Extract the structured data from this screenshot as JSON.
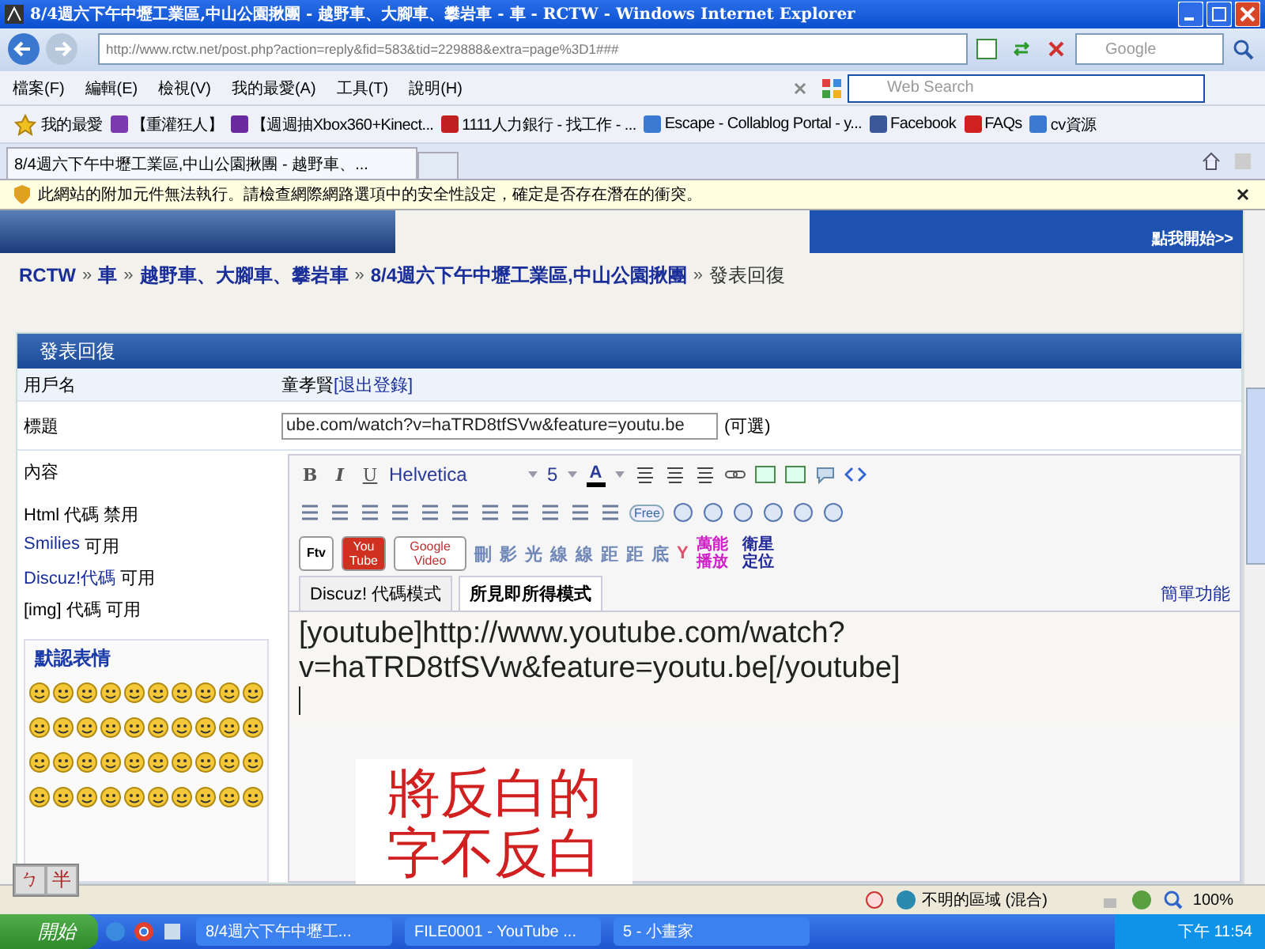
{
  "window": {
    "title": "8/4週六下午中壢工業區,中山公園揪團 - 越野車、大腳車、攀岩車 - 車 - RCTW - Windows Internet Explorer"
  },
  "address_bar": {
    "url": "http://www.rctw.net/post.php?action=reply&fid=583&tid=229888&extra=page%3D1###"
  },
  "search_box": {
    "placeholder": "Google"
  },
  "menu": [
    "檔案(F)",
    "編輯(E)",
    "檢視(V)",
    "我的最愛(A)",
    "工具(T)",
    "說明(H)"
  ],
  "web_search": {
    "placeholder": "Web Search"
  },
  "favorites_bar": {
    "label": "我的最愛",
    "items": [
      "【重灌狂人】",
      "【週週抽Xbox360+Kinect...",
      "1111人力銀行 - 找工作 - ...",
      "Escape - Collablog Portal - y...",
      "Facebook",
      "FAQs",
      "cv資源"
    ]
  },
  "tabs": [
    {
      "label": "8/4週六下午中壢工業區,中山公園揪團 - 越野車、...",
      "selected": true
    }
  ],
  "info_bar": {
    "message": "此網站的附加元件無法執行。請檢查網際網路選項中的安全性設定，確定是否存在潛在的衝突。"
  },
  "banner": {
    "link": "點我開始>>"
  },
  "breadcrumb": [
    {
      "text": "RCTW",
      "kind": "link"
    },
    {
      "text": "»",
      "kind": "separator"
    },
    {
      "text": "車",
      "kind": "link"
    },
    {
      "text": "»",
      "kind": "separator"
    },
    {
      "text": "越野車、大腳車、攀岩車",
      "kind": "link"
    },
    {
      "text": "»",
      "kind": "separator"
    },
    {
      "text": "8/4週六下午中壢工業區,中山公園揪團",
      "kind": "link"
    },
    {
      "text": "»",
      "kind": "separator"
    },
    {
      "text": "發表回復",
      "kind": "current"
    }
  ],
  "form": {
    "title": "發表回復",
    "username_label": "用戶名",
    "username": "童孝賢",
    "logout_link": "[退出登錄]",
    "subject_label": "標題",
    "subject_value": "ube.com/watch?v=haTRD8tfSVw&feature=youtu.be",
    "subject_note": "(可選)",
    "content_label": "內容",
    "options": [
      {
        "name": "Html 代碼",
        "status": "禁用",
        "kind": "plain"
      },
      {
        "name": "Smilies",
        "status": "可用",
        "kind": "link"
      },
      {
        "name": "Discuz!代碼",
        "status": "可用",
        "kind": "link"
      },
      {
        "name": "[img] 代碼",
        "status": "可用",
        "kind": "plain"
      }
    ],
    "smilies_title": "默認表情"
  },
  "editor": {
    "format_buttons": [
      "B",
      "I",
      "U"
    ],
    "font": "Helvetica",
    "size": "5",
    "color_button": "A",
    "free_label": "Free",
    "media_buttons": [
      "Ftv",
      "You Tube",
      "Google Video"
    ],
    "glyph_buttons": [
      {
        "text": "刪",
        "color": "#7088b8"
      },
      {
        "text": "影",
        "color": "#7088b8"
      },
      {
        "text": "光",
        "color": "#7088b8"
      },
      {
        "text": "線",
        "color": "#7088b8"
      },
      {
        "text": "線",
        "color": "#7088b8"
      },
      {
        "text": "距",
        "color": "#7088b8"
      },
      {
        "text": "距",
        "color": "#7088b8"
      },
      {
        "text": "底",
        "color": "#7088b8"
      },
      {
        "text": "Y",
        "color": "#e0506a"
      },
      {
        "text": "萬能播放",
        "color": "#d020c8"
      },
      {
        "text": "衛星定位",
        "color": "#202898"
      }
    ],
    "mode_tabs": [
      {
        "label": "Discuz! 代碼模式",
        "selected": false
      },
      {
        "label": "所見即所得模式",
        "selected": true
      }
    ],
    "simple_link": "簡單功能",
    "content": "[youtube]http://www.youtube.com/watch?v=haTRD8tfSVw&feature=youtu.be[/youtube]"
  },
  "annotation": {
    "lines": [
      "將反白的",
      "字不反白"
    ]
  },
  "ime": [
    "ㄅ",
    "半"
  ],
  "status_bar": {
    "zone": "不明的區域 (混合)",
    "zoom": "100%"
  },
  "taskbar": {
    "start": "開始",
    "tasks": [
      "8/4週六下午中壢工...",
      "FILE0001 - YouTube ...",
      "5 - 小畫家"
    ],
    "clock": "下午 11:54"
  }
}
